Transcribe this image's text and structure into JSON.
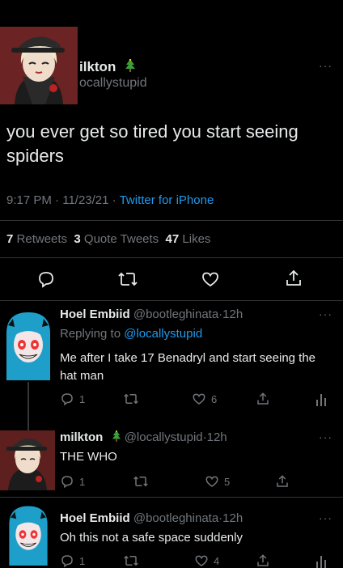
{
  "main_tweet": {
    "display_name": "ilkton",
    "handle": "ocallystupid",
    "text": "you ever get so tired you start seeing spiders",
    "time": "9:17 PM",
    "date": "11/23/21",
    "source": "Twitter for iPhone",
    "stats": {
      "retweets_count": "7",
      "retweets_label": "Retweets",
      "quotes_count": "3",
      "quotes_label": "Quote Tweets",
      "likes_count": "47",
      "likes_label": "Likes"
    }
  },
  "replies": [
    {
      "display_name": "Hoel Embiid",
      "handle": "@bootleghinata",
      "time": "12h",
      "replying_to_label": "Replying to",
      "replying_to_handle": "@locallystupid",
      "text": "Me after I take 17 Benadryl and start seeing the hat man",
      "reply_count": "1",
      "retweet_count": "",
      "like_count": "6"
    },
    {
      "display_name": "milkton",
      "handle": "@locallystupid",
      "time": "12h",
      "text": "THE WHO",
      "reply_count": "1",
      "retweet_count": "",
      "like_count": "5"
    },
    {
      "display_name": "Hoel Embiid",
      "handle": "@bootleghinata",
      "time": "12h",
      "text": "Oh this not a safe space suddenly",
      "reply_count": "1",
      "retweet_count": "",
      "like_count": "4"
    }
  ],
  "separator": "·",
  "more_label": "···",
  "colors": {
    "background": "#000000",
    "text": "#e7e9ea",
    "muted": "#71767b",
    "link": "#1d9bf0"
  },
  "icons": [
    "reply-icon",
    "retweet-icon",
    "like-icon",
    "share-icon",
    "analytics-icon",
    "tree-emoji-icon",
    "more-icon"
  ]
}
